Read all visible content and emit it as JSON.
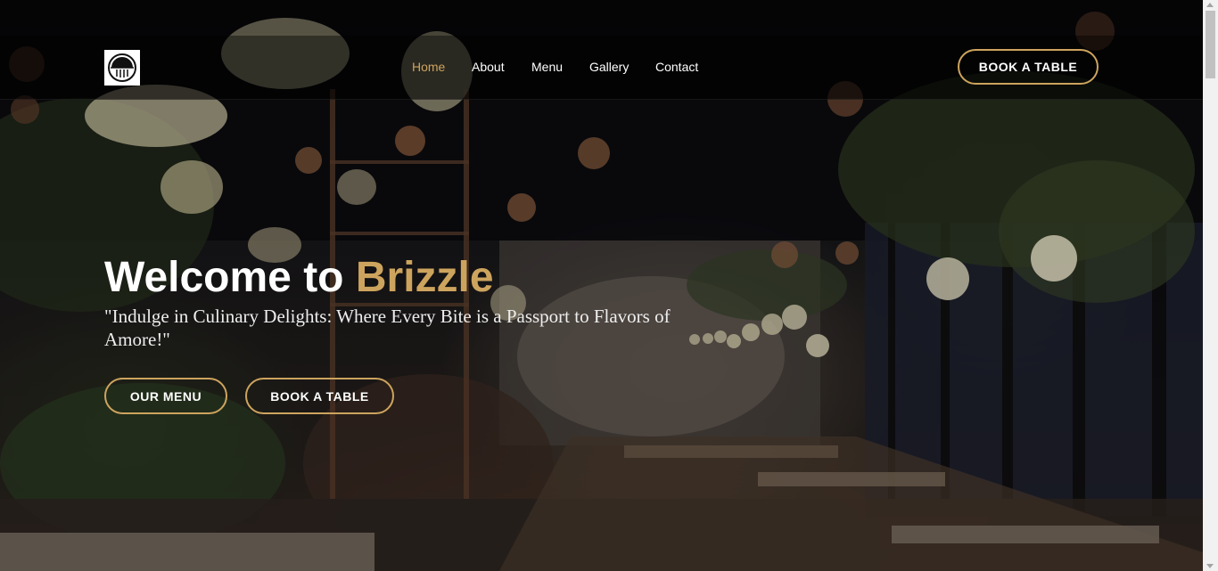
{
  "nav": {
    "items": [
      {
        "label": "Home",
        "active": true
      },
      {
        "label": "About",
        "active": false
      },
      {
        "label": "Menu",
        "active": false
      },
      {
        "label": "Gallery",
        "active": false
      },
      {
        "label": "Contact",
        "active": false
      }
    ],
    "book_button": "BOOK A TABLE"
  },
  "hero": {
    "title_prefix": "Welcome to ",
    "brand": "Brizzle",
    "tagline": "\"Indulge in Culinary Delights: Where Every Bite is a Passport to Flavors of Amore!\"",
    "menu_button": "OUR MENU",
    "book_button": "BOOK A TABLE"
  },
  "colors": {
    "accent": "#cda45e",
    "header_bg": "#000000",
    "text": "#ffffff"
  },
  "icons": {
    "logo": "restaurant-logo-icon"
  }
}
